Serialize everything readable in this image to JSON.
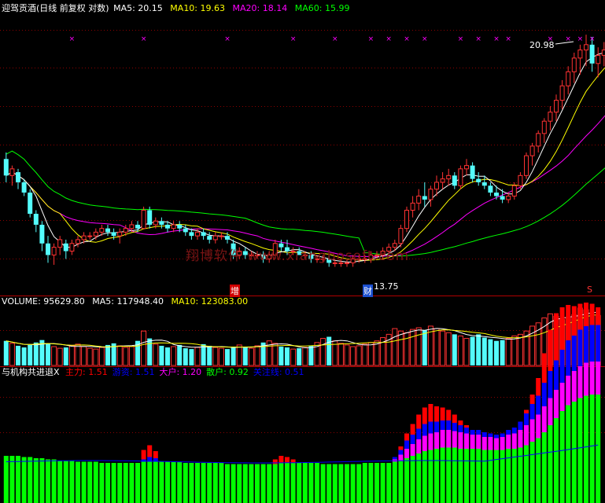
{
  "colors": {
    "background": "#000000",
    "up": "#ff3232",
    "down": "#54fcfc",
    "ma5": "#ffffff",
    "ma10": "#ffff00",
    "ma20": "#ff00ff",
    "ma60": "#00ff00",
    "grid": "#8a0000",
    "zhuli": "#ff0000",
    "youzi": "#0000ff",
    "dahu": "#ff00ff",
    "sanhu": "#00ff00",
    "guanzhu": "#0000ff"
  },
  "price_panel": {
    "title": "迎驾贡酒(日线 前复权 对数)",
    "ma5_label": "MA5: 20.15",
    "ma10_label": "MA10: 19.63",
    "ma20_label": "MA20: 18.14",
    "ma60_label": "MA60: 15.99",
    "high_label": "20.98",
    "low_label": "13.75",
    "marker_zeng": "增",
    "marker_cai": "财",
    "marker_s": "S",
    "watermark": "翔博软件 www.xiangbosoft.com"
  },
  "volume_panel": {
    "vol_label": "VOLUME: 95629.80",
    "ma5_label": "MA5: 117948.40",
    "ma10_label": "MA10: 123083.00"
  },
  "indicator_panel": {
    "name": "与机构共进退X",
    "items": [
      {
        "label": "主力: 1.51",
        "color": "#ff0000"
      },
      {
        "label": "游资: 1.51",
        "color": "#0000ff"
      },
      {
        "label": "大户: 1.20",
        "color": "#ff00ff"
      },
      {
        "label": "散户: 0.92",
        "color": "#00ff00"
      },
      {
        "label": "关注线: 0.51",
        "color": "#0000ff"
      }
    ]
  },
  "chart_data": [
    {
      "type": "candlestick",
      "title": "迎驾贡酒(日线 前复权 对数)",
      "scale": "log",
      "ylim": [
        13.3,
        21.6
      ],
      "annotations": [
        "20.98",
        "13.75"
      ],
      "candles": [
        [
          16.7,
          16.9,
          16.0,
          16.2
        ],
        [
          16.2,
          16.5,
          15.9,
          16.4
        ],
        [
          16.3,
          16.4,
          15.8,
          16.0
        ],
        [
          16.0,
          16.1,
          15.6,
          15.7
        ],
        [
          15.7,
          15.8,
          15.0,
          15.1
        ],
        [
          15.1,
          15.2,
          14.6,
          14.8
        ],
        [
          14.8,
          14.9,
          14.1,
          14.3
        ],
        [
          14.3,
          14.5,
          13.8,
          14.0
        ],
        [
          14.0,
          14.3,
          13.75,
          14.2
        ],
        [
          14.2,
          14.5,
          14.0,
          14.4
        ],
        [
          14.3,
          14.4,
          13.9,
          14.1
        ],
        [
          14.1,
          14.4,
          14.0,
          14.3
        ],
        [
          14.3,
          14.5,
          14.2,
          14.4
        ],
        [
          14.4,
          14.6,
          14.3,
          14.5
        ],
        [
          14.5,
          14.6,
          14.4,
          14.5
        ],
        [
          14.5,
          14.7,
          14.4,
          14.6
        ],
        [
          14.6,
          14.8,
          14.5,
          14.7
        ],
        [
          14.7,
          14.8,
          14.5,
          14.6
        ],
        [
          14.6,
          14.7,
          14.4,
          14.5
        ],
        [
          14.5,
          14.7,
          14.3,
          14.6
        ],
        [
          14.6,
          14.8,
          14.5,
          14.7
        ],
        [
          14.7,
          14.9,
          14.6,
          14.8
        ],
        [
          14.8,
          14.9,
          14.6,
          14.7
        ],
        [
          14.7,
          15.3,
          14.7,
          15.2
        ],
        [
          15.2,
          15.3,
          14.7,
          14.8
        ],
        [
          14.8,
          15.0,
          14.7,
          14.9
        ],
        [
          14.9,
          15.0,
          14.7,
          14.8
        ],
        [
          14.8,
          14.9,
          14.6,
          14.7
        ],
        [
          14.7,
          14.9,
          14.6,
          14.8
        ],
        [
          14.8,
          14.9,
          14.6,
          14.7
        ],
        [
          14.7,
          14.8,
          14.5,
          14.6
        ],
        [
          14.6,
          14.7,
          14.4,
          14.5
        ],
        [
          14.5,
          14.7,
          14.4,
          14.6
        ],
        [
          14.6,
          14.7,
          14.4,
          14.5
        ],
        [
          14.5,
          14.6,
          14.3,
          14.4
        ],
        [
          14.4,
          14.6,
          14.3,
          14.5
        ],
        [
          14.5,
          14.6,
          14.4,
          14.5
        ],
        [
          14.5,
          14.6,
          14.3,
          14.4
        ],
        [
          14.3,
          14.4,
          13.9,
          14.0
        ],
        [
          14.0,
          14.2,
          13.9,
          14.1
        ],
        [
          14.1,
          14.2,
          13.9,
          14.0
        ],
        [
          14.0,
          14.1,
          13.9,
          14.0
        ],
        [
          14.0,
          14.1,
          13.9,
          14.0
        ],
        [
          14.0,
          14.1,
          13.8,
          13.9
        ],
        [
          13.9,
          14.1,
          13.8,
          14.0
        ],
        [
          14.0,
          14.4,
          13.9,
          14.3
        ],
        [
          14.3,
          14.4,
          14.1,
          14.2
        ],
        [
          14.2,
          14.4,
          14.0,
          14.1
        ],
        [
          14.1,
          14.2,
          14.0,
          14.1
        ],
        [
          14.1,
          14.2,
          14.0,
          14.0
        ],
        [
          14.0,
          14.1,
          13.9,
          14.0
        ],
        [
          14.0,
          14.1,
          13.8,
          13.9
        ],
        [
          13.9,
          14.0,
          13.8,
          13.9
        ],
        [
          13.9,
          14.0,
          13.8,
          13.9
        ],
        [
          13.9,
          14.0,
          13.7,
          13.8
        ],
        [
          13.8,
          13.9,
          13.7,
          13.8
        ],
        [
          13.8,
          13.9,
          13.7,
          13.8
        ],
        [
          13.8,
          13.9,
          13.7,
          13.8
        ],
        [
          13.8,
          14.0,
          13.7,
          13.9
        ],
        [
          13.9,
          14.0,
          13.8,
          13.9
        ],
        [
          13.9,
          14.0,
          13.8,
          13.9
        ],
        [
          13.9,
          14.1,
          13.8,
          14.0
        ],
        [
          14.0,
          14.1,
          13.9,
          14.0
        ],
        [
          14.0,
          14.2,
          13.9,
          14.1
        ],
        [
          14.1,
          14.3,
          14.0,
          14.2
        ],
        [
          14.2,
          14.4,
          14.1,
          14.3
        ],
        [
          14.3,
          14.8,
          14.2,
          14.7
        ],
        [
          14.7,
          15.3,
          14.6,
          15.2
        ],
        [
          15.2,
          15.6,
          15.0,
          15.4
        ],
        [
          15.4,
          15.8,
          15.2,
          15.6
        ],
        [
          15.6,
          16.0,
          15.3,
          15.5
        ],
        [
          15.5,
          15.9,
          15.3,
          15.8
        ],
        [
          15.8,
          16.2,
          15.6,
          16.0
        ],
        [
          16.0,
          16.3,
          15.8,
          16.1
        ],
        [
          16.1,
          16.4,
          15.9,
          16.2
        ],
        [
          16.2,
          16.3,
          15.8,
          15.9
        ],
        [
          15.9,
          16.5,
          15.8,
          16.4
        ],
        [
          16.4,
          16.7,
          16.2,
          16.5
        ],
        [
          16.5,
          16.6,
          16.0,
          16.1
        ],
        [
          16.1,
          16.3,
          15.9,
          16.0
        ],
        [
          16.0,
          16.2,
          15.8,
          15.9
        ],
        [
          15.9,
          16.0,
          15.6,
          15.7
        ],
        [
          15.7,
          15.9,
          15.5,
          15.6
        ],
        [
          15.6,
          15.8,
          15.4,
          15.5
        ],
        [
          15.5,
          15.7,
          15.4,
          15.6
        ],
        [
          15.6,
          16.0,
          15.5,
          15.9
        ],
        [
          15.9,
          16.3,
          15.8,
          16.2
        ],
        [
          16.2,
          16.9,
          16.1,
          16.8
        ],
        [
          16.8,
          17.2,
          16.5,
          17.1
        ],
        [
          17.1,
          17.6,
          16.9,
          17.5
        ],
        [
          17.5,
          18.0,
          17.2,
          17.9
        ],
        [
          17.9,
          18.4,
          17.6,
          18.2
        ],
        [
          18.2,
          18.8,
          17.9,
          18.6
        ],
        [
          18.6,
          19.3,
          18.3,
          19.1
        ],
        [
          19.1,
          19.8,
          18.8,
          19.6
        ],
        [
          19.6,
          20.3,
          19.2,
          20.1
        ],
        [
          20.1,
          20.6,
          19.5,
          20.4
        ],
        [
          20.4,
          20.98,
          19.8,
          20.6
        ],
        [
          20.6,
          20.9,
          19.6,
          19.9
        ],
        [
          19.9,
          20.5,
          19.4,
          20.2
        ],
        [
          20.2,
          20.7,
          19.8,
          20.4
        ],
        [
          20.4,
          20.8,
          19.9,
          20.15
        ]
      ],
      "ma5_last": 20.15,
      "ma10_last": 19.63,
      "ma20_last": 18.14,
      "ma60_last": 15.99
    },
    {
      "type": "bar",
      "title": "VOLUME",
      "volumes": [
        30,
        27,
        24,
        22,
        25,
        28,
        31,
        27,
        23,
        21,
        22,
        24,
        26,
        23,
        21,
        20,
        22,
        25,
        27,
        24,
        22,
        23,
        30,
        42,
        33,
        26,
        24,
        22,
        23,
        25,
        21,
        20,
        22,
        26,
        24,
        22,
        21,
        20,
        23,
        25,
        22,
        21,
        24,
        28,
        30,
        27,
        23,
        22,
        20,
        21,
        22,
        24,
        28,
        33,
        35,
        30,
        27,
        25,
        23,
        24,
        26,
        28,
        30,
        34,
        38,
        45,
        42,
        40,
        44,
        46,
        43,
        48,
        45,
        42,
        40,
        38,
        36,
        33,
        35,
        38,
        34,
        32,
        30,
        31,
        33,
        36,
        38,
        42,
        48,
        52,
        58,
        63,
        60,
        56,
        58,
        62,
        70,
        68,
        64,
        61
      ],
      "last": 95629.8,
      "ma5_last": 117948.4,
      "ma10_last": 123083.0
    },
    {
      "type": "bar",
      "title": "与机构共进退X",
      "series": [
        {
          "name": "散户",
          "values": [
            0.4,
            0.4,
            0.4,
            0.39,
            0.39,
            0.38,
            0.38,
            0.37,
            0.37,
            0.36,
            0.36,
            0.36,
            0.35,
            0.35,
            0.35,
            0.35,
            0.34,
            0.34,
            0.34,
            0.34,
            0.34,
            0.34,
            0.34,
            0.35,
            0.35,
            0.35,
            0.35,
            0.35,
            0.35,
            0.35,
            0.34,
            0.34,
            0.34,
            0.34,
            0.34,
            0.34,
            0.34,
            0.33,
            0.33,
            0.33,
            0.33,
            0.33,
            0.33,
            0.33,
            0.33,
            0.33,
            0.34,
            0.34,
            0.34,
            0.34,
            0.34,
            0.34,
            0.34,
            0.33,
            0.33,
            0.33,
            0.33,
            0.33,
            0.33,
            0.33,
            0.34,
            0.34,
            0.34,
            0.34,
            0.34,
            0.35,
            0.36,
            0.38,
            0.4,
            0.42,
            0.44,
            0.45,
            0.46,
            0.47,
            0.47,
            0.47,
            0.46,
            0.46,
            0.46,
            0.46,
            0.45,
            0.45,
            0.45,
            0.45,
            0.46,
            0.46,
            0.47,
            0.49,
            0.52,
            0.55,
            0.6,
            0.66,
            0.72,
            0.78,
            0.83,
            0.86,
            0.89,
            0.91,
            0.92,
            0.92
          ]
        },
        {
          "name": "大户",
          "values": [
            0,
            0,
            0,
            0,
            0,
            0,
            0,
            0,
            0,
            0,
            0,
            0,
            0,
            0,
            0,
            0,
            0,
            0,
            0,
            0,
            0,
            0,
            0,
            0,
            0,
            0,
            0,
            0,
            0,
            0,
            0,
            0,
            0,
            0,
            0,
            0,
            0,
            0,
            0,
            0,
            0,
            0,
            0,
            0,
            0,
            0,
            0,
            0,
            0,
            0,
            0,
            0,
            0,
            0,
            0,
            0,
            0,
            0,
            0,
            0,
            0,
            0,
            0,
            0,
            0,
            0.02,
            0.05,
            0.08,
            0.1,
            0.12,
            0.13,
            0.14,
            0.14,
            0.15,
            0.15,
            0.14,
            0.14,
            0.13,
            0.12,
            0.12,
            0.11,
            0.11,
            0.1,
            0.11,
            0.12,
            0.13,
            0.15,
            0.17,
            0.19,
            0.2,
            0.22,
            0.23,
            0.24,
            0.24,
            0.25,
            0.26,
            0.27,
            0.28,
            0.28,
            0.28
          ]
        },
        {
          "name": "游资",
          "values": [
            0,
            0,
            0,
            0,
            0,
            0,
            0,
            0,
            0,
            0,
            0,
            0,
            0,
            0,
            0,
            0,
            0,
            0,
            0,
            0,
            0,
            0,
            0,
            0.02,
            0.04,
            0.03,
            0,
            0,
            0,
            0,
            0,
            0,
            0,
            0,
            0,
            0,
            0,
            0,
            0,
            0,
            0,
            0,
            0,
            0,
            0,
            0,
            0,
            0,
            0,
            0,
            0,
            0,
            0,
            0,
            0,
            0,
            0,
            0,
            0,
            0,
            0,
            0,
            0,
            0,
            0,
            0.02,
            0.04,
            0.07,
            0.08,
            0.09,
            0.1,
            0.1,
            0.09,
            0.08,
            0.08,
            0.07,
            0.06,
            0.05,
            0.04,
            0.04,
            0.04,
            0.03,
            0.03,
            0.03,
            0.04,
            0.05,
            0.07,
            0.1,
            0.13,
            0.16,
            0.2,
            0.23,
            0.25,
            0.28,
            0.3,
            0.3,
            0.31,
            0.31,
            0.31,
            0.31
          ]
        },
        {
          "name": "主力",
          "values": [
            0,
            0,
            0,
            0,
            0,
            0,
            0,
            0,
            0,
            0,
            0,
            0,
            0,
            0,
            0,
            0,
            0,
            0,
            0,
            0,
            0,
            0,
            0,
            0.08,
            0.1,
            0.06,
            0,
            0,
            0,
            0,
            0,
            0,
            0,
            0,
            0,
            0,
            0,
            0,
            0,
            0,
            0,
            0,
            0,
            0,
            0,
            0.04,
            0.06,
            0.05,
            0.03,
            0,
            0,
            0,
            0,
            0,
            0,
            0,
            0,
            0,
            0,
            0,
            0,
            0,
            0,
            0,
            0,
            0,
            0.03,
            0.06,
            0.09,
            0.12,
            0.14,
            0.15,
            0.13,
            0.11,
            0.09,
            0.07,
            0.04,
            0.02,
            0,
            0,
            0,
            0,
            0,
            0,
            0,
            0,
            0,
            0.03,
            0.08,
            0.15,
            0.25,
            0.35,
            0.4,
            0.36,
            0.3,
            0.25,
            0.22,
            0.2,
            0.18,
            0.15
          ]
        }
      ],
      "guanzhu_line": 0.51
    }
  ]
}
